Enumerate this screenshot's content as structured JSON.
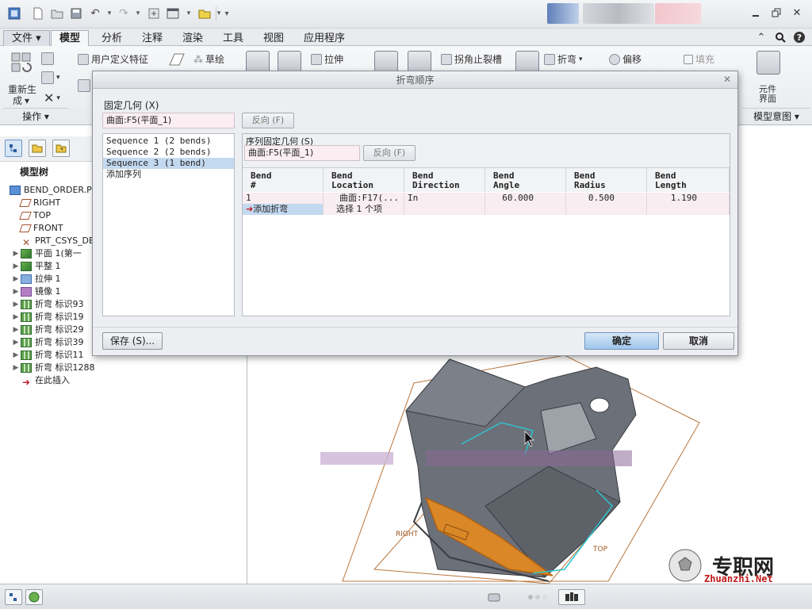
{
  "ribbon": {
    "tabs": [
      "文件",
      "模型",
      "分析",
      "注释",
      "渲染",
      "工具",
      "视图",
      "应用程序"
    ],
    "active_tab": "模型",
    "items": {
      "regenerate": "重新生",
      "regenerate_2": "成",
      "user_defined_feature": "用户定义特征",
      "sketch": "草绘",
      "extrude": "拉伸",
      "corner_relief": "拐角止裂槽",
      "bend": "折弯",
      "offset": "偏移",
      "fill": "填充",
      "component_interface": "元件",
      "component_interface_2": "界面"
    },
    "groups": {
      "operations": "操作",
      "model_intent": "模型意图"
    }
  },
  "tree": {
    "title": "模型树",
    "items": [
      {
        "label": "BEND_ORDER.PRT",
        "icon": "part-icon",
        "expand": ""
      },
      {
        "label": "RIGHT",
        "icon": "datum-plane-icon",
        "expand": ""
      },
      {
        "label": "TOP",
        "icon": "datum-plane-icon",
        "expand": ""
      },
      {
        "label": "FRONT",
        "icon": "datum-plane-icon",
        "expand": ""
      },
      {
        "label": "PRT_CSYS_DEF",
        "icon": "csys-icon",
        "expand": ""
      },
      {
        "label": "平面 1(第一",
        "icon": "planar-wall-icon",
        "expand": "▶"
      },
      {
        "label": "平整 1",
        "icon": "flat-wall-icon",
        "expand": "▶"
      },
      {
        "label": "拉伸 1",
        "icon": "extrude-icon",
        "expand": "▶"
      },
      {
        "label": "镜像 1",
        "icon": "mirror-icon",
        "expand": "▶"
      },
      {
        "label": "折弯 标识93",
        "icon": "bend-icon",
        "expand": "▶"
      },
      {
        "label": "折弯 标识19",
        "icon": "bend-icon",
        "expand": "▶"
      },
      {
        "label": "折弯 标识29",
        "icon": "bend-icon",
        "expand": "▶"
      },
      {
        "label": "折弯 标识39",
        "icon": "bend-icon",
        "expand": "▶"
      },
      {
        "label": "折弯 标识11",
        "icon": "bend-icon",
        "expand": "▶"
      },
      {
        "label": "折弯 标识1288",
        "icon": "bend-icon",
        "expand": "▶"
      },
      {
        "label": "在此插入",
        "icon": "insert-here-icon",
        "expand": ""
      }
    ]
  },
  "dialog": {
    "title": "折弯顺序",
    "fixed_geometry_label": "固定几何 (X)",
    "fixed_geometry_value": "曲面:F5(平面_1)",
    "flip_label": "反向 (F)",
    "sequences": [
      "Sequence 1 (2 bends)",
      "Sequence 2 (2 bends)",
      "Sequence 3 (1 bend)",
      "添加序列"
    ],
    "selected_sequence": 2,
    "seq_fixed_geometry_label": "序列固定几何 (S)",
    "seq_fixed_geometry_value": "曲面:F5(平面_1)",
    "seq_flip_label": "反向 (F)",
    "table": {
      "headers": [
        [
          "Bend",
          "#"
        ],
        [
          "Bend",
          "Location"
        ],
        [
          "Bend",
          "Direction"
        ],
        [
          "Bend",
          "Angle"
        ],
        [
          "Bend",
          "Radius"
        ],
        [
          "Bend",
          "Length"
        ]
      ],
      "rows": [
        [
          "1",
          "曲面:F17(...",
          "In",
          "60.000",
          "0.500",
          "1.190"
        ]
      ],
      "add_row": [
        "添加折弯",
        "选择 1 个项"
      ]
    },
    "save_label": "保存 (S)...",
    "ok_label": "确定",
    "cancel_label": "取消"
  },
  "viewport": {
    "labels": [
      "RIGHT",
      "TOP"
    ]
  },
  "watermark": {
    "cn": "专职网",
    "en": "Zhuanzhi.Net"
  },
  "colors": {
    "accent": "#9fc5ea",
    "selection": "#c3d9f0",
    "highlight_orange": "#e58a1f",
    "model_gray": "#6c7078",
    "datum_brown": "#a0522d"
  }
}
